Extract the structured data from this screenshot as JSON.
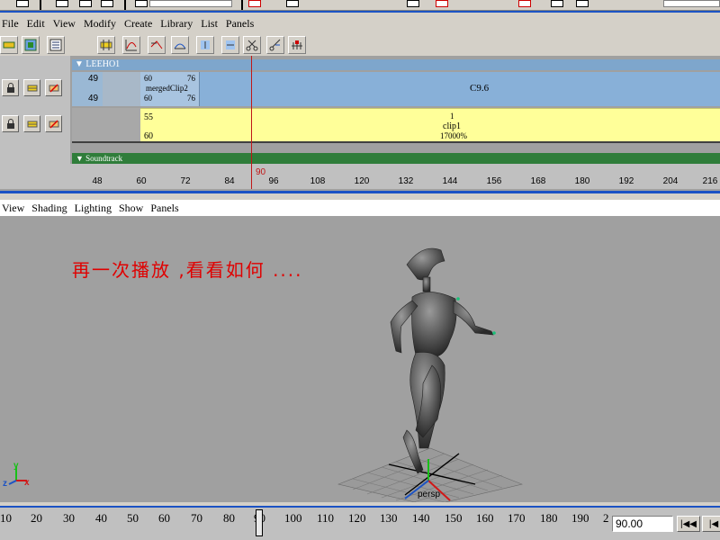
{
  "trax_menu": [
    "File",
    "Edit",
    "View",
    "Modify",
    "Create",
    "Library",
    "List",
    "Panels"
  ],
  "character_set": "LEEHO1",
  "track1": {
    "start": "49",
    "end": "49",
    "merged_clip": {
      "name": "mergedClip2",
      "start": "60",
      "end": "60",
      "start_end": "76",
      "end_end": "76"
    },
    "big_clip_name": "C9.6"
  },
  "track2": {
    "start": "55",
    "end": "60",
    "clip": {
      "index": "1",
      "name": "clip1",
      "scale": "17000%"
    }
  },
  "soundtrack_label": "Soundtrack",
  "current_frame_label": "90",
  "ruler_ticks": [
    "48",
    "60",
    "72",
    "84",
    "96",
    "108",
    "120",
    "132",
    "144",
    "156",
    "168",
    "180",
    "192",
    "204",
    "216"
  ],
  "viewport_menu": [
    "View",
    "Shading",
    "Lighting",
    "Show",
    "Panels"
  ],
  "caption": "再一次播放 ,看看如何 ....",
  "camera_label": "persp",
  "time_numbers": [
    "10",
    "20",
    "30",
    "40",
    "50",
    "60",
    "70",
    "80",
    "90",
    "100",
    "110",
    "120",
    "130",
    "140",
    "150",
    "160",
    "170",
    "180",
    "190",
    "2"
  ],
  "current_time": "90.00",
  "colors": {
    "accent": "#1c53c4",
    "playhead": "#c01818",
    "caption": "#e00000",
    "track_clip": "#88b0d8",
    "active_clip": "#ffff99",
    "soundtrack": "#2f7d3a"
  }
}
